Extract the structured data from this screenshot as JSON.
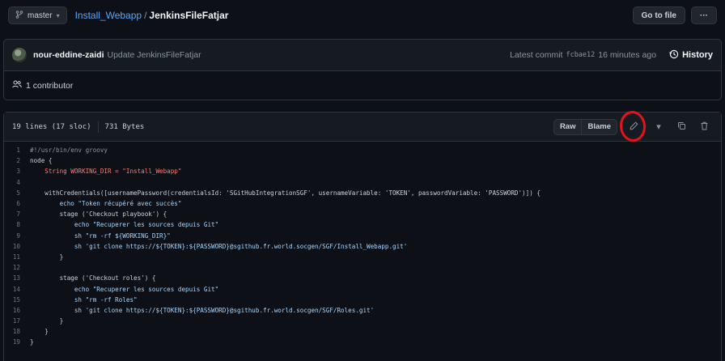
{
  "header": {
    "branch": "master",
    "repo": "Install_Webapp",
    "separator": "/",
    "file": "JenkinsFileFatjar",
    "go_to_file": "Go to file",
    "more": "···"
  },
  "commit": {
    "author": "nour-eddine-zaidi",
    "message": "Update JenkinsFileFatjar",
    "latest_label": "Latest commit",
    "hash": "fcbae12",
    "time": "16 minutes ago",
    "history": "History"
  },
  "contributors": {
    "label": "1 contributor"
  },
  "file": {
    "lines": "19 lines (17 sloc)",
    "size": "731 Bytes",
    "raw": "Raw",
    "blame": "Blame"
  },
  "colors": {
    "highlight_ring": "#e3131b",
    "link": "#58a6ff"
  },
  "code": [
    "#!/usr/bin/env groovy",
    "node {",
    "    String WORKING_DIR = \"Install_Webapp\"",
    "",
    "    withCredentials([usernamePassword(credentialsId: 'SGitHubIntegrationSGF', usernameVariable: 'TOKEN', passwordVariable: 'PASSWORD')]) {",
    "        echo \"Token récupéré avec succès\"",
    "        stage ('Checkout playbook') {",
    "            echo \"Recuperer les sources depuis Git\"",
    "            sh \"rm -rf ${WORKING_DIR}\"",
    "            sh 'git clone https://${TOKEN}:${PASSWORD}@sgithub.fr.world.socgen/SGF/Install_Webapp.git'",
    "        }",
    "",
    "        stage ('Checkout roles') {",
    "            echo \"Recuperer les sources depuis Git\"",
    "            sh \"rm -rf Roles\"",
    "            sh 'git clone https://${TOKEN}:${PASSWORD}@sgithub.fr.world.socgen/SGF/Roles.git'",
    "        }",
    "    }",
    "}"
  ]
}
